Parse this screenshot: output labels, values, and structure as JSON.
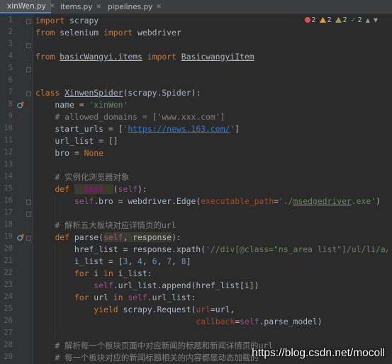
{
  "tabs": [
    {
      "label": "xinWen.py",
      "active": true,
      "icon": "python-file-icon"
    },
    {
      "label": "items.py",
      "active": false,
      "icon": "python-file-icon"
    },
    {
      "label": "pipelines.py",
      "active": false,
      "icon": "python-file-icon"
    }
  ],
  "inspections": {
    "errors": "2",
    "warnings": "2",
    "weak_warnings": "2",
    "ok": "2",
    "colors": {
      "error": "#e0504a",
      "warning": "#e3a32b",
      "weak_warning": "#a09c4b",
      "ok": "#5c9e50"
    }
  },
  "line_numbers": [
    "1",
    "2",
    "3",
    "4",
    "5",
    "6",
    "7",
    "8",
    "9",
    "10",
    "11",
    "12",
    "13",
    "14",
    "15",
    "16",
    "17",
    "18",
    "19",
    "20",
    "21",
    "22",
    "23",
    "24",
    "25",
    "26",
    "27",
    "28",
    "29"
  ],
  "code": {
    "l1_kw": "import",
    "l1_rest": " scrapy",
    "l2_kw1": "from",
    "l2_mod": " selenium ",
    "l2_kw2": "import",
    "l2_rest": " webdriver",
    "l4_kw1": "from",
    "l4_mod": "basicWangyi.items",
    "l4_kw2": "import",
    "l4_cls": "BasicwangyiItem",
    "l7_kw": "class",
    "l7_name": "XinwenSpider",
    "l7_rest": "(scrapy.Spider):",
    "l8_a": "    name = ",
    "l8_s": "'xinWen'",
    "l9_c": "    # allowed_domains = ['www.xxx.com']",
    "l10_a": "    start_urls = [",
    "l10_q1": "'",
    "l10_url": "https://news.163.com/",
    "l10_q2": "'",
    "l10_b": "]",
    "l11": "    url_list = []",
    "l12_a": "    bro = ",
    "l12_k": "None",
    "l14_c": "    # 实例化浏览器对象",
    "l15_ind": "    ",
    "l15_def": "def",
    "l15_sp": " ",
    "l15_init": "__init__",
    "l15_p": "(",
    "l15_self": "self",
    "l15_e": "):",
    "l16_ind": "        ",
    "l16_self": "self",
    "l16_a": ".bro = webdriver.Edge(",
    "l16_p": "executable_path",
    "l16_eq": "=",
    "l16_s1": "'./",
    "l16_s2": "msedgedriver",
    "l16_s3": ".exe'",
    "l16_e": ")",
    "l18_c": "    # 解析五大板块对应详情页的url",
    "l19_ind": "    ",
    "l19_def": "def",
    "l19_n": " parse",
    "l19_p": "(",
    "l19_self": "self",
    "l19_c": ", ",
    "l19_resp": "response",
    "l19_e": "):",
    "l20_a": "        href_list = response.xpath(",
    "l20_s": "'//div[@class=\"ns_area list\"]/ul/li/a/@hre",
    "l21_a": "        i_list = [",
    "l21_n1": "3",
    "l21_n2": "4",
    "l21_n3": "6",
    "l21_n4": "7",
    "l21_n5": "8",
    "l21_sep": ", ",
    "l21_e": "]",
    "l22_ind": "        ",
    "l22_for": "for",
    "l22_a": " i ",
    "l22_in": "in",
    "l22_b": " i_list:",
    "l23_ind": "            ",
    "l23_self": "self",
    "l23_a": ".url_list.append(href_list[i])",
    "l24_ind": "        ",
    "l24_for": "for",
    "l24_a": " url ",
    "l24_in": "in",
    "l24_sp": " ",
    "l24_self": "self",
    "l24_b": ".url_list:",
    "l25_ind": "            ",
    "l25_y": "yield",
    "l25_a": " scrapy.Request(",
    "l25_p": "url",
    "l25_b": "=url,",
    "l26_ind": "                                 ",
    "l26_p": "callback",
    "l26_eq": "=",
    "l26_self": "self",
    "l26_b": ".parse_model)",
    "l28_c": "    # 解析每一个板块页面中对应新闻的标题和新闻详情页的url",
    "l29_c": "    # 每一个板块对应的新闻标题相关的内容都是动态加载的"
  },
  "watermark": "https://blog.csdn.net/mocoll"
}
